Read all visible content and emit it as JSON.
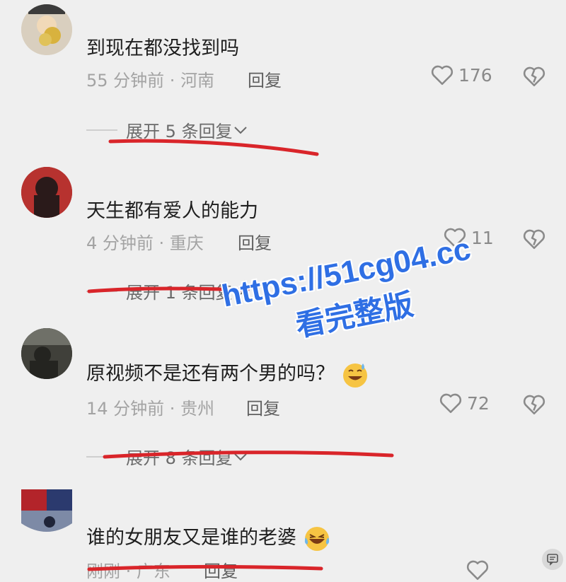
{
  "comments": [
    {
      "username": "",
      "text": "到现在都没找到吗",
      "time": "55 分钟前",
      "location": "河南",
      "reply_label": "回复",
      "likes": "176",
      "expand_label": "展开 5 条回复"
    },
    {
      "username": "",
      "text": "天生都有爱人的能力",
      "time": "4 分钟前",
      "location": "重庆",
      "reply_label": "回复",
      "likes": "11",
      "expand_label": "展开 1 条回复"
    },
    {
      "username": "",
      "text": "原视频不是还有两个男的吗？",
      "time": "14 分钟前",
      "location": "贵州",
      "reply_label": "回复",
      "likes": "72",
      "expand_label": "展开 8 条回复"
    },
    {
      "username": "",
      "text": "谁的女朋友又是谁的老婆",
      "time": "刚刚",
      "location": "广东",
      "reply_label": "回复",
      "likes": ""
    }
  ],
  "separator": " · ",
  "watermark": {
    "line1": "https://51cg04.cc",
    "line2": "看完整版"
  },
  "colors": {
    "background": "#efefef",
    "annotation_red": "#d9252a",
    "watermark_blue": "#2f6fe4"
  },
  "icons": [
    "heart-outline-icon",
    "broken-heart-icon",
    "chevron-down-icon",
    "sweat-smile-emoji",
    "crying-laugh-emoji",
    "chat-bubble-icon"
  ]
}
